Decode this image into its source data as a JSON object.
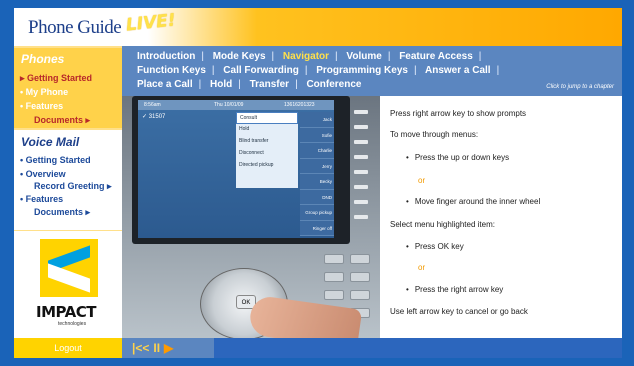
{
  "app": {
    "logo_text": "Phone Guide",
    "logo_live": "LIVE!"
  },
  "sidebar": {
    "phones": {
      "title": "Phones",
      "items": [
        {
          "label": "▸ Getting Started"
        },
        {
          "label": "• My Phone"
        },
        {
          "label": "• Features"
        },
        {
          "label": "Documents ▸"
        }
      ]
    },
    "voice_mail": {
      "title": "Voice Mail",
      "items": [
        {
          "label": "• Getting Started"
        },
        {
          "label": "• Overview"
        },
        {
          "label": "Record Greeting ▸"
        },
        {
          "label": "• Features"
        },
        {
          "label": "Documents ▸"
        }
      ]
    },
    "logo": {
      "name": "IMPACT",
      "sub": "technologies"
    },
    "logout": "Logout"
  },
  "topnav": {
    "row1": [
      "Introduction",
      "Mode Keys",
      "Navigator",
      "Volume",
      "Feature Access"
    ],
    "row2": [
      "Function Keys",
      "Call Forwarding",
      "Programming Keys",
      "Answer a Call"
    ],
    "row3": [
      "Place a Call",
      "Hold",
      "Transfer",
      "Conference"
    ],
    "active": "Navigator",
    "jump_hint": "Click to jump to a chapter"
  },
  "phone_screen": {
    "time": "8:56am",
    "date": "Thu 10/01/09",
    "extension": "13616201323",
    "line": "31507",
    "menu": [
      "Consult",
      "Hold",
      "Blind transfer",
      "Disconnect",
      "Directed pickup"
    ],
    "names": [
      "Jack",
      "Sofie",
      "Charlie",
      "Jerry",
      "Becky",
      "DND",
      "Group pickup",
      "Ringer off",
      "Shift"
    ],
    "ok_label": "OK"
  },
  "instructions": {
    "line1": "Press right arrow key to show prompts",
    "line2": "To move through menus:",
    "bullet1": "Press the up or down keys",
    "or1": "or",
    "bullet2": "Move finger around the inner wheel",
    "line3": "Select menu highlighted item:",
    "bullet3": "Press OK key",
    "or2": "or",
    "bullet4": "Press the right arrow key",
    "line4": "Use left arrow key to cancel or go back"
  },
  "controls": {
    "rewind": "|<<",
    "pause": "II",
    "play": "▶"
  },
  "colors": {
    "accent": "#ffd300",
    "nav_bg": "#5b86c0",
    "active_nav": "#ffe04a",
    "or_color": "#f29a00"
  }
}
